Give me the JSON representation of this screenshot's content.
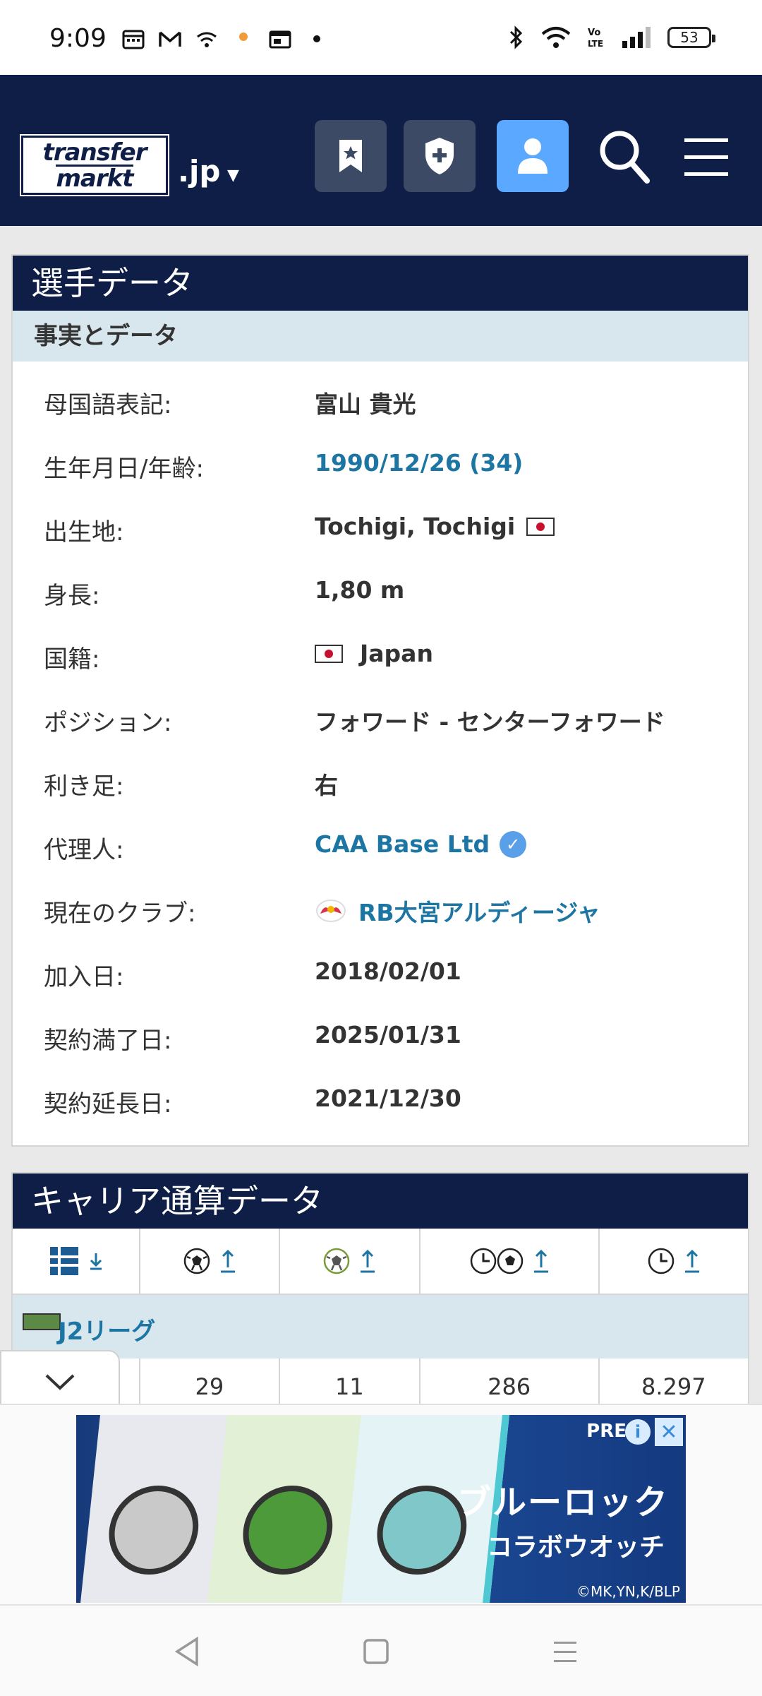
{
  "status_bar": {
    "time": "9:09",
    "battery": "53",
    "left_icons": [
      "calendar-icon",
      "gmail-icon",
      "wifi-call-icon",
      "notification-dot-icon",
      "calendar-app-icon",
      "more-dot-icon"
    ],
    "right_icons": [
      "bluetooth-icon",
      "wifi-icon",
      "volte-icon",
      "signal-icon",
      "battery-icon"
    ]
  },
  "header": {
    "logo_line1": "transfer",
    "logo_line2": "markt",
    "domain": ".jp",
    "buttons": [
      "bookmark-icon",
      "shield-plus-icon",
      "user-icon",
      "search-icon",
      "menu-icon"
    ]
  },
  "player_data": {
    "title": "選手データ",
    "subtitle": "事実とデータ",
    "rows": [
      {
        "label": "母国語表記:",
        "value": "富山 貴光"
      },
      {
        "label": "生年月日/年齢:",
        "value": "1990/12/26 (34)"
      },
      {
        "label": "出生地:",
        "value": "Tochigi, Tochigi"
      },
      {
        "label": "身長:",
        "value": "1,80 m"
      },
      {
        "label": "国籍:",
        "value": "Japan"
      },
      {
        "label": "ポジション:",
        "value": "フォワード - センターフォワード"
      },
      {
        "label": "利き足:",
        "value": "右"
      },
      {
        "label": "代理人:",
        "value": "CAA Base Ltd"
      },
      {
        "label": "現在のクラブ:",
        "value": "RB大宮アルディージャ"
      },
      {
        "label": "加入日:",
        "value": "2018/02/01"
      },
      {
        "label": "契約満了日:",
        "value": "2025/01/31"
      },
      {
        "label": "契約延長日:",
        "value": "2021/12/30"
      }
    ]
  },
  "career": {
    "title": "キャリア通算データ",
    "columns": [
      "appearances-icon",
      "goals-icon",
      "assists-icon",
      "minutes-per-goal-icon",
      "minutes-played-icon"
    ],
    "league": "J2リーグ",
    "row": [
      "29",
      "11",
      "286",
      "8.297"
    ]
  },
  "ad": {
    "brand": "PRE",
    "title": "ブルーロック",
    "subtitle": "コラボウオッチ",
    "copyright": "©MK,YN,K/BLP",
    "info": "i",
    "close": "✕"
  },
  "colors": {
    "navy": "#0e1e46",
    "link": "#1d75a3",
    "subheader_bg": "#d8e6ee",
    "active_button": "#5aa8ff"
  }
}
